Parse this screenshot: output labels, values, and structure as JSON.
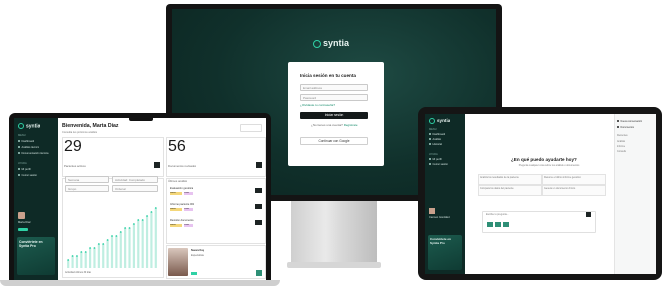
{
  "brand": {
    "name": "syntia",
    "accent": "#2fd1a5",
    "dark": "#0e2a26"
  },
  "monitor": {
    "login_title": "Inicia sesión en tu cuenta",
    "email_placeholder": "Email address",
    "password_placeholder": "Password",
    "forgot_link": "¿Olvidaste tu contraseña?",
    "login_button": "Iniciar sesión",
    "no_account_text": "¿No tienes una cuenta?",
    "register_link": "Regístrate",
    "google_button": "Continuar con Google"
  },
  "laptop": {
    "sidebar": {
      "section_main": "MENÚ",
      "items": [
        "Dashboard",
        "Análisis técnico",
        "Documentación técnica"
      ],
      "section_help": "AYUDA",
      "help_items": [
        "Mi perfil",
        "Cerrar sesión"
      ],
      "user_name": "Marta Díaz",
      "promo_text": "Conviértete en Syntia Pro"
    },
    "greeting": "Bienvenida, Marta Díaz",
    "greeting_sub": "Consulta tus próximos análisis",
    "stat_left": {
      "value": "29",
      "label": "Pacientes activos"
    },
    "stat_right": {
      "value": "56",
      "label": "Documentos revisados"
    },
    "filters": [
      "Semana",
      "Actividad: Completado",
      "Grupo",
      "Ordenar"
    ],
    "list_header": "Últimos análisis",
    "list_items": [
      {
        "title": "Evaluación genética",
        "tag1": "Nuevo",
        "tag2": "Pend."
      },
      {
        "title": "Informe paciente 001",
        "tag1": "Nuevo",
        "tag2": "Pend."
      },
      {
        "title": "Revisión documento",
        "tag1": "Nuevo",
        "tag2": "Pend."
      }
    ],
    "profile_card": {
      "name": "Nueva Kay",
      "role": "Especialista"
    },
    "chart_footer": "Actividad últimos 30 días",
    "chart_data": {
      "type": "bar",
      "values": [
        2,
        3,
        3,
        4,
        4,
        5,
        5,
        6,
        6,
        7,
        8,
        8,
        9,
        10,
        10,
        11,
        12,
        12,
        13,
        14,
        15
      ],
      "ylim": [
        0,
        16
      ]
    }
  },
  "tablet": {
    "sidebar": {
      "section_main": "MENÚ",
      "items": [
        "Dashboard",
        "Análisis",
        "Historial"
      ],
      "section_help": "AYUDA",
      "help_items": [
        "Mi perfil",
        "Cerrar sesión"
      ],
      "user_name": "Carmen González",
      "promo_text": "Conviértete en Syntia Pro"
    },
    "question": "¿En qué puedo ayudarte hoy?",
    "question_sub": "Pregunta cualquier cosa sobre tus análisis o documentos",
    "suggestions": [
      "Analiza los resultados de la paciente",
      "Resume el último informe genético",
      "Compara los datos del paciente",
      "Genera un documento clínico"
    ],
    "input_placeholder": "Escribe tu pregunta...",
    "right_panel": {
      "items": [
        "Nueva conversación",
        "Documentos"
      ],
      "section": "Recientes",
      "recent": [
        "Análisis",
        "Informe",
        "Consulta"
      ]
    }
  }
}
